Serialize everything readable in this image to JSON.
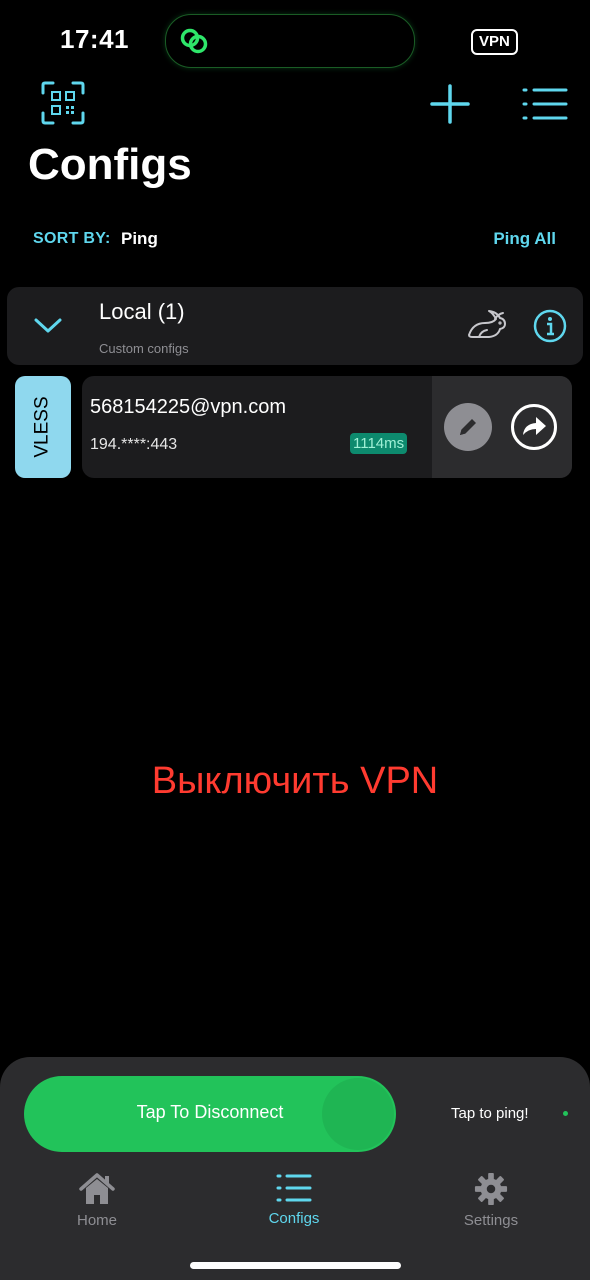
{
  "status_bar": {
    "time": "17:41",
    "vpn_badge": "VPN",
    "island_icon": "link-icon"
  },
  "toolbar": {
    "qr_icon": "qr-scan-icon",
    "add_icon": "plus-icon",
    "menu_icon": "list-icon"
  },
  "title": "Configs",
  "sort": {
    "label": "SORT BY:",
    "value": "Ping",
    "ping_all": "Ping All"
  },
  "group": {
    "title": "Local (1)",
    "subtitle": "Custom configs"
  },
  "config": {
    "type": "VLESS",
    "name": "568154225@vpn.com",
    "address": "194.****:443",
    "ping": "1114ms"
  },
  "center_text": "Выключить VPN",
  "bottom": {
    "connect_label": "Tap To Disconnect",
    "tap_ping": "Tap to ping!"
  },
  "tabs": [
    {
      "label": "Home",
      "icon": "home-icon",
      "active": false
    },
    {
      "label": "Configs",
      "icon": "list-icon",
      "active": true
    },
    {
      "label": "Settings",
      "icon": "gear-icon",
      "active": false
    }
  ],
  "colors": {
    "accent": "#5fd7ee",
    "connect": "#22c35a",
    "danger": "#ff3b30",
    "ping_badge": "#0d8a6e",
    "tag": "#8fd8ee"
  }
}
